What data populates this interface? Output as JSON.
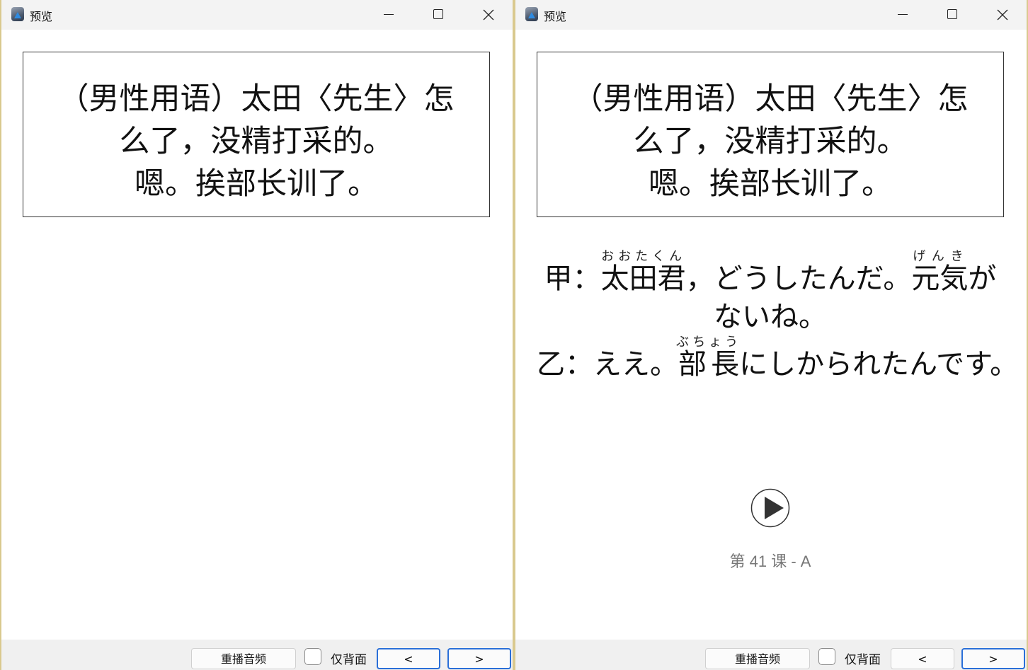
{
  "left_window": {
    "title": "预览",
    "front_text": "（男性用语）太田〈先生〉怎\n么了，没精打采的。\n嗯。挨部长训了。",
    "bottom_bar": {
      "replay_label": "重播音频",
      "back_only_label": "仅背面",
      "back_only_checked": false,
      "prev_label": "<",
      "next_label": ">"
    }
  },
  "right_window": {
    "title": "预览",
    "front_text": "（男性用语）太田〈先生〉怎\n么了，没精打采的。\n嗯。挨部长训了。",
    "back": {
      "line1": {
        "prefix": "甲：",
        "base1": "太田君",
        "ruby1": "おおたくん",
        "mid": "，どうしたんだ。",
        "base2": "元気",
        "ruby2": "げんき",
        "suffix": "が"
      },
      "line2": "ないね。",
      "line3": {
        "prefix": "乙：ええ。",
        "base": "部長",
        "ruby": "ぶちょう",
        "suffix": "にしかられたんです。"
      }
    },
    "play_icon": "play-circle-icon",
    "lesson_label": "第 41 课 - A",
    "bottom_bar": {
      "replay_label": "重播音频",
      "back_only_label": "仅背面",
      "back_only_checked": false,
      "prev_label": "<",
      "next_label": ">"
    }
  },
  "icons": {
    "app": "app-icon",
    "minimize": "minimize-icon",
    "maximize": "maximize-icon",
    "close": "close-icon"
  },
  "colors": {
    "desktop": "#d9c98e",
    "focus_border": "#2a6fd8",
    "lesson_text": "#777777"
  }
}
